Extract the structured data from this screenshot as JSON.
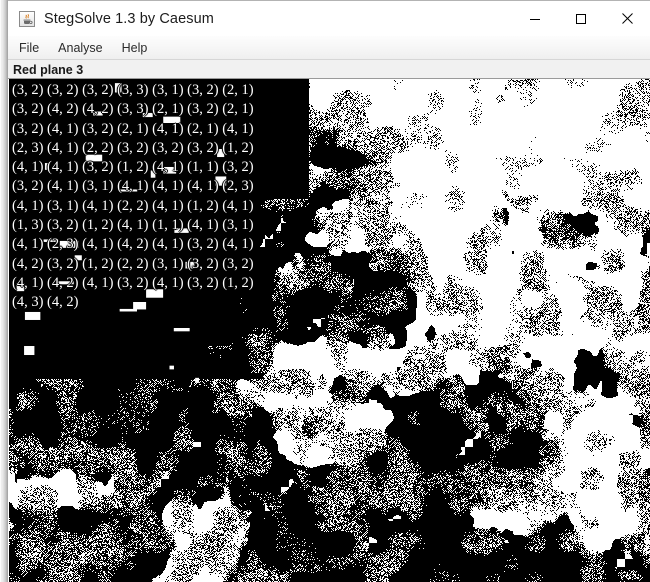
{
  "window": {
    "title": "StegSolve 1.3 by Caesum",
    "app_icon": "java-coffee-cup-icon",
    "controls": {
      "minimize": "minimize-button",
      "maximize": "maximize-button",
      "close": "close-button"
    }
  },
  "menubar": {
    "items": [
      {
        "label": "File"
      },
      {
        "label": "Analyse"
      },
      {
        "label": "Help"
      }
    ]
  },
  "status": {
    "plane_label": "Red plane 3"
  },
  "image_view": {
    "description": "binary-thresholded bit-plane image",
    "background_color": "#ffffff",
    "foreground_color": "#000000",
    "overlay_rows": [
      "(3, 2) (3, 2) (3, 2) (3, 3) (3, 1) (3, 2) (2, 1)",
      "(3, 2) (4, 2) (4, 2) (3, 3) (2, 1) (3, 2) (2, 1)",
      "(3, 2) (4, 1) (3, 2) (2, 1) (4, 1) (2, 1) (4, 1)",
      "(2, 3) (4, 1) (2, 2) (3, 2) (3, 2) (3, 2) (1, 2)",
      "(4, 1) (4, 1) (3, 2) (1, 2) (4, 1) (1, 1) (3, 2)",
      "(3, 2) (4, 1) (3, 1) (4, 1) (4, 1) (4, 1) (2, 3)",
      "(4, 1) (3, 1) (4, 1) (2, 2) (4, 1) (1, 2) (4, 1)",
      "(1, 3) (3, 2) (1, 2) (4, 1) (1, 1) (4, 1) (3, 1)",
      "(4, 1) (2, 3) (4, 1) (4, 2) (4, 1) (3, 2) (4, 1)",
      "(4, 2) (3, 2) (1, 2) (2, 2) (3, 1) (3, 2) (3, 2)",
      "(4, 1) (4, 2) (4, 1) (3, 2) (4, 1) (3, 2) (1, 2)",
      "(4, 3) (4, 2)"
    ]
  },
  "colors": {
    "titlebar_background": "#ffffff",
    "titlebar_text": "#1c1c1c",
    "menubar_background": "#f6f6f6",
    "statusbar_background": "#f1f1f1",
    "frame_border": "#9e9e9e"
  }
}
